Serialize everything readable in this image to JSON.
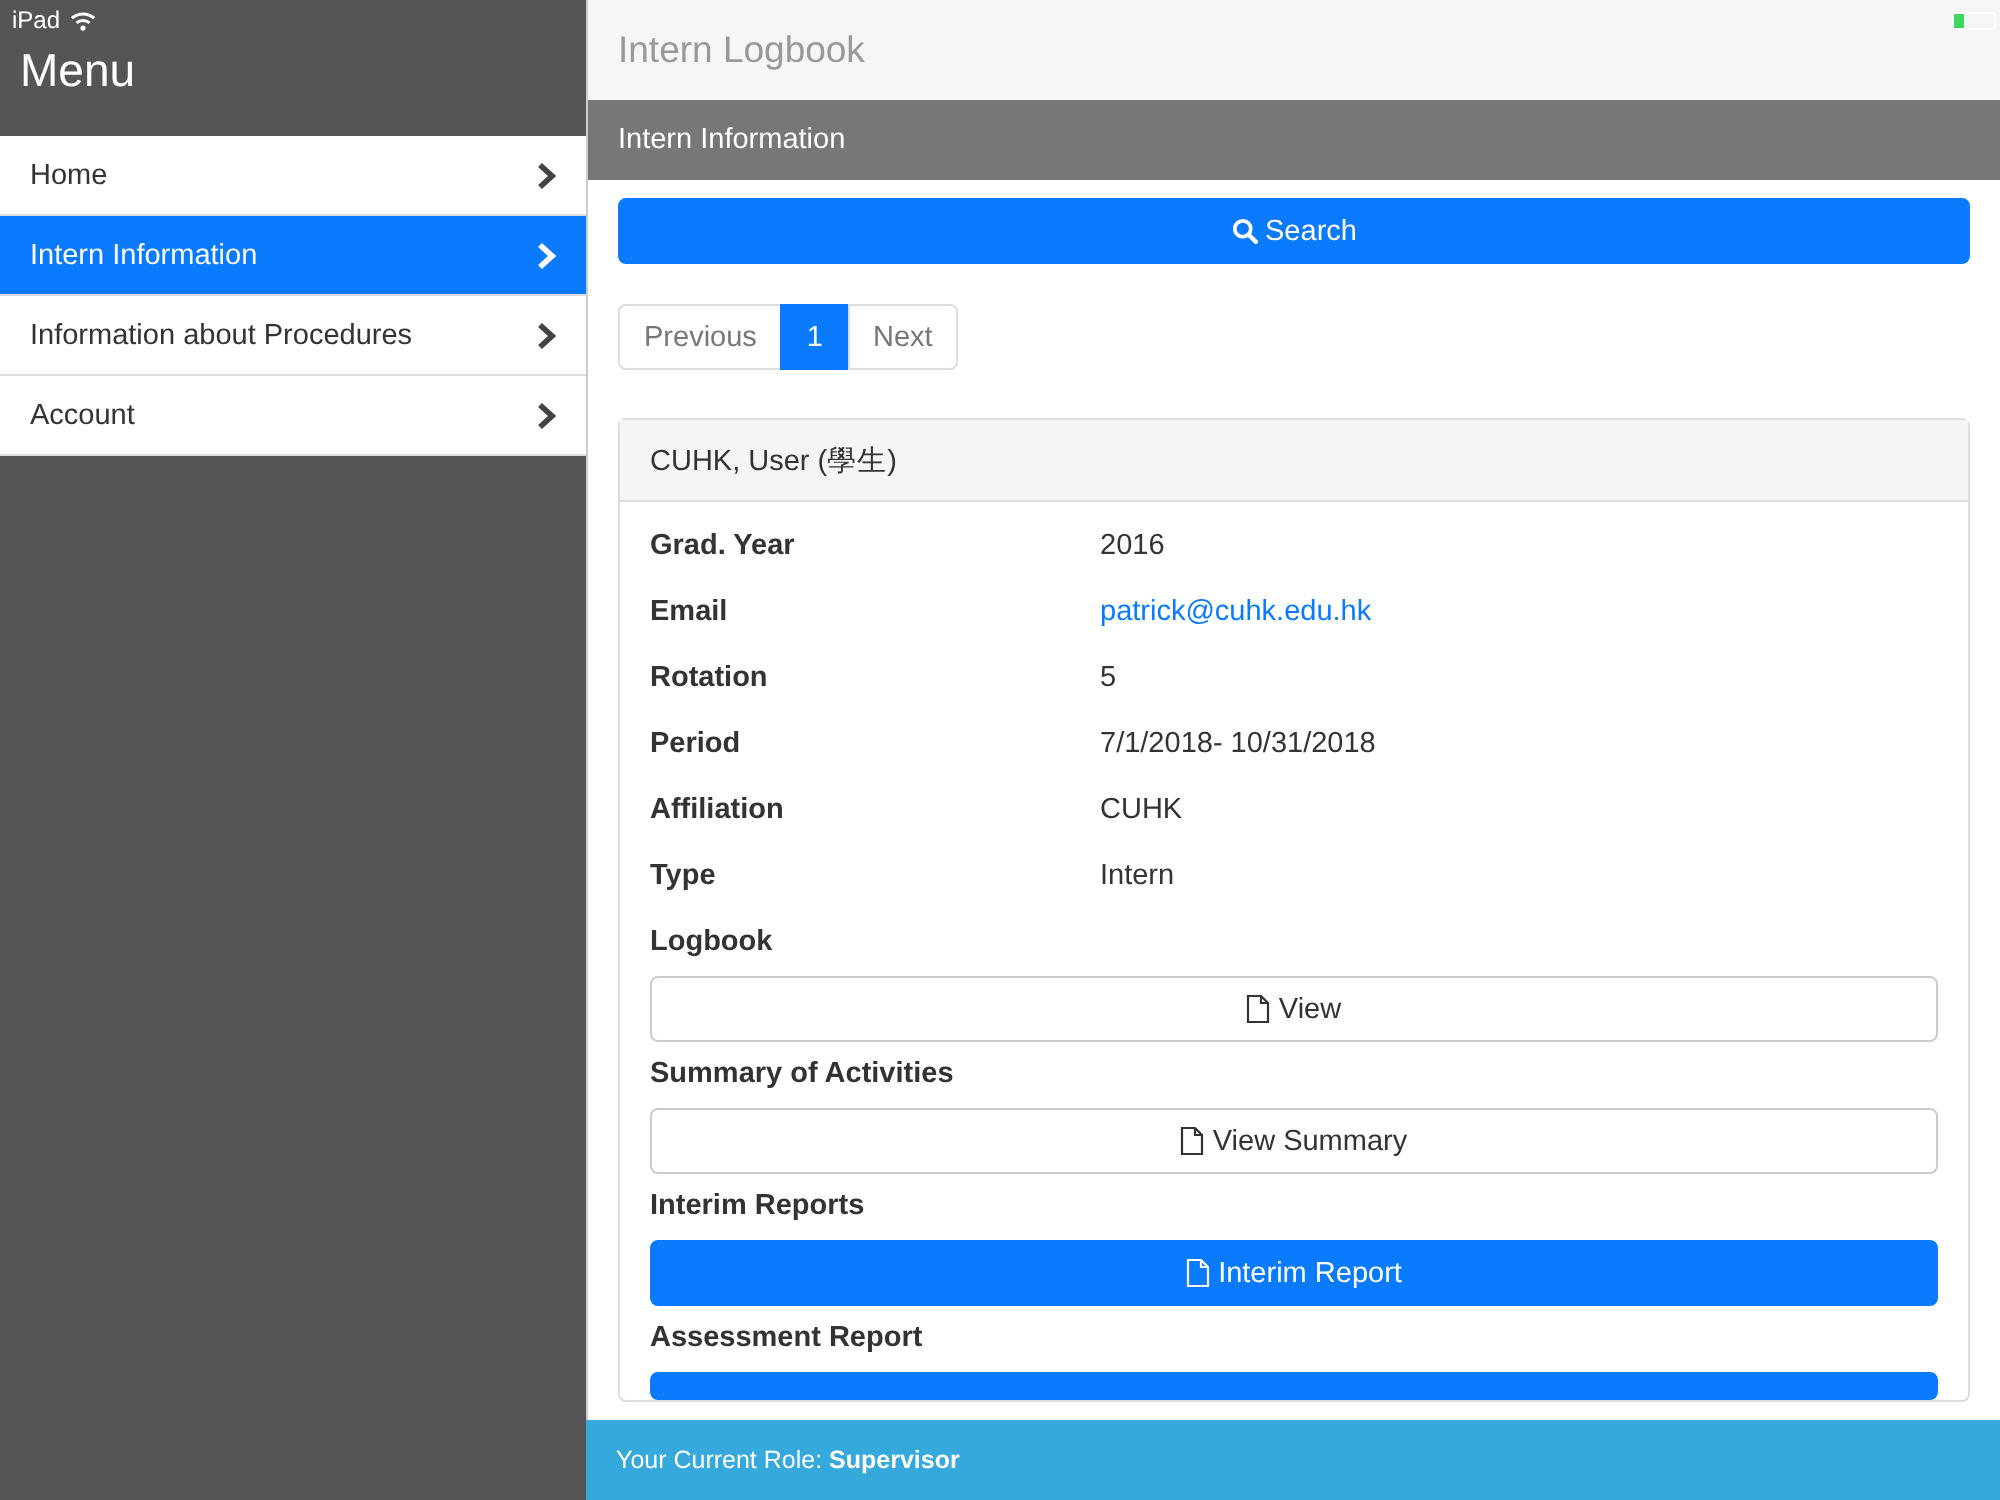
{
  "status_bar": {
    "device": "iPad"
  },
  "sidebar": {
    "title": "Menu",
    "items": [
      {
        "label": "Home",
        "selected": false
      },
      {
        "label": "Intern Information",
        "selected": true
      },
      {
        "label": "Information about Procedures",
        "selected": false
      },
      {
        "label": "Account",
        "selected": false
      }
    ]
  },
  "header": {
    "title": "Intern Logbook"
  },
  "section": {
    "title": "Intern Information"
  },
  "search_button": "Search",
  "pagination": [
    {
      "label": "Previous",
      "selected": false
    },
    {
      "label": "1",
      "selected": true
    },
    {
      "label": "Next",
      "selected": false
    }
  ],
  "card": {
    "title": "CUHK, User (學生)",
    "fields": [
      {
        "label": "Grad. Year",
        "value": "2016",
        "kind": "text"
      },
      {
        "label": "Email",
        "value": "patrick@cuhk.edu.hk",
        "kind": "link"
      },
      {
        "label": "Rotation",
        "value": "5",
        "kind": "text"
      },
      {
        "label": "Period",
        "value": "7/1/2018- 10/31/2018",
        "kind": "text"
      },
      {
        "label": "Affiliation",
        "value": "CUHK",
        "kind": "text"
      },
      {
        "label": "Type",
        "value": "Intern",
        "kind": "text"
      }
    ],
    "sections": [
      {
        "label": "Logbook",
        "button": "View",
        "kind": "default"
      },
      {
        "label": "Summary of Activities",
        "button": "View Summary",
        "kind": "default"
      },
      {
        "label": "Interim Reports",
        "button": "Interim Report",
        "kind": "primary"
      },
      {
        "label": "Assessment Report",
        "kind": "primary"
      }
    ]
  },
  "footer": {
    "text": "Your Current Role: **Supervisor**"
  }
}
